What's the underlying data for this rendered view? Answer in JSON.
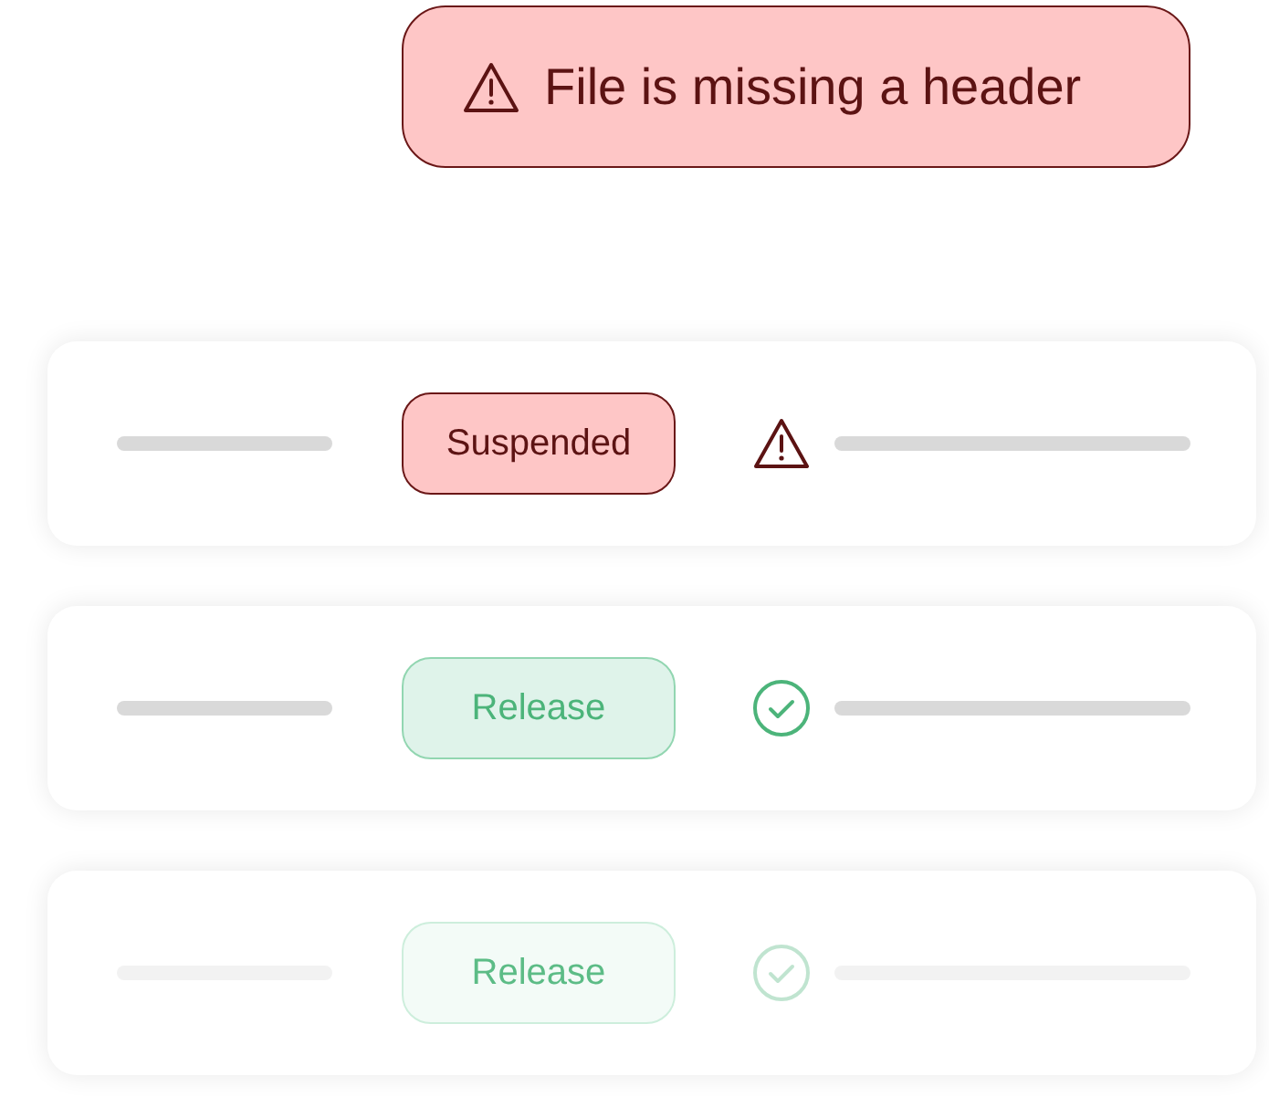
{
  "toast": {
    "kind": "warning",
    "message": "File is missing a header"
  },
  "rows": [
    {
      "kind": "warning",
      "status": "Suspended",
      "dimmed": false
    },
    {
      "kind": "success",
      "status": "Release",
      "dimmed": false
    },
    {
      "kind": "success",
      "status": "Release",
      "dimmed": true
    }
  ]
}
